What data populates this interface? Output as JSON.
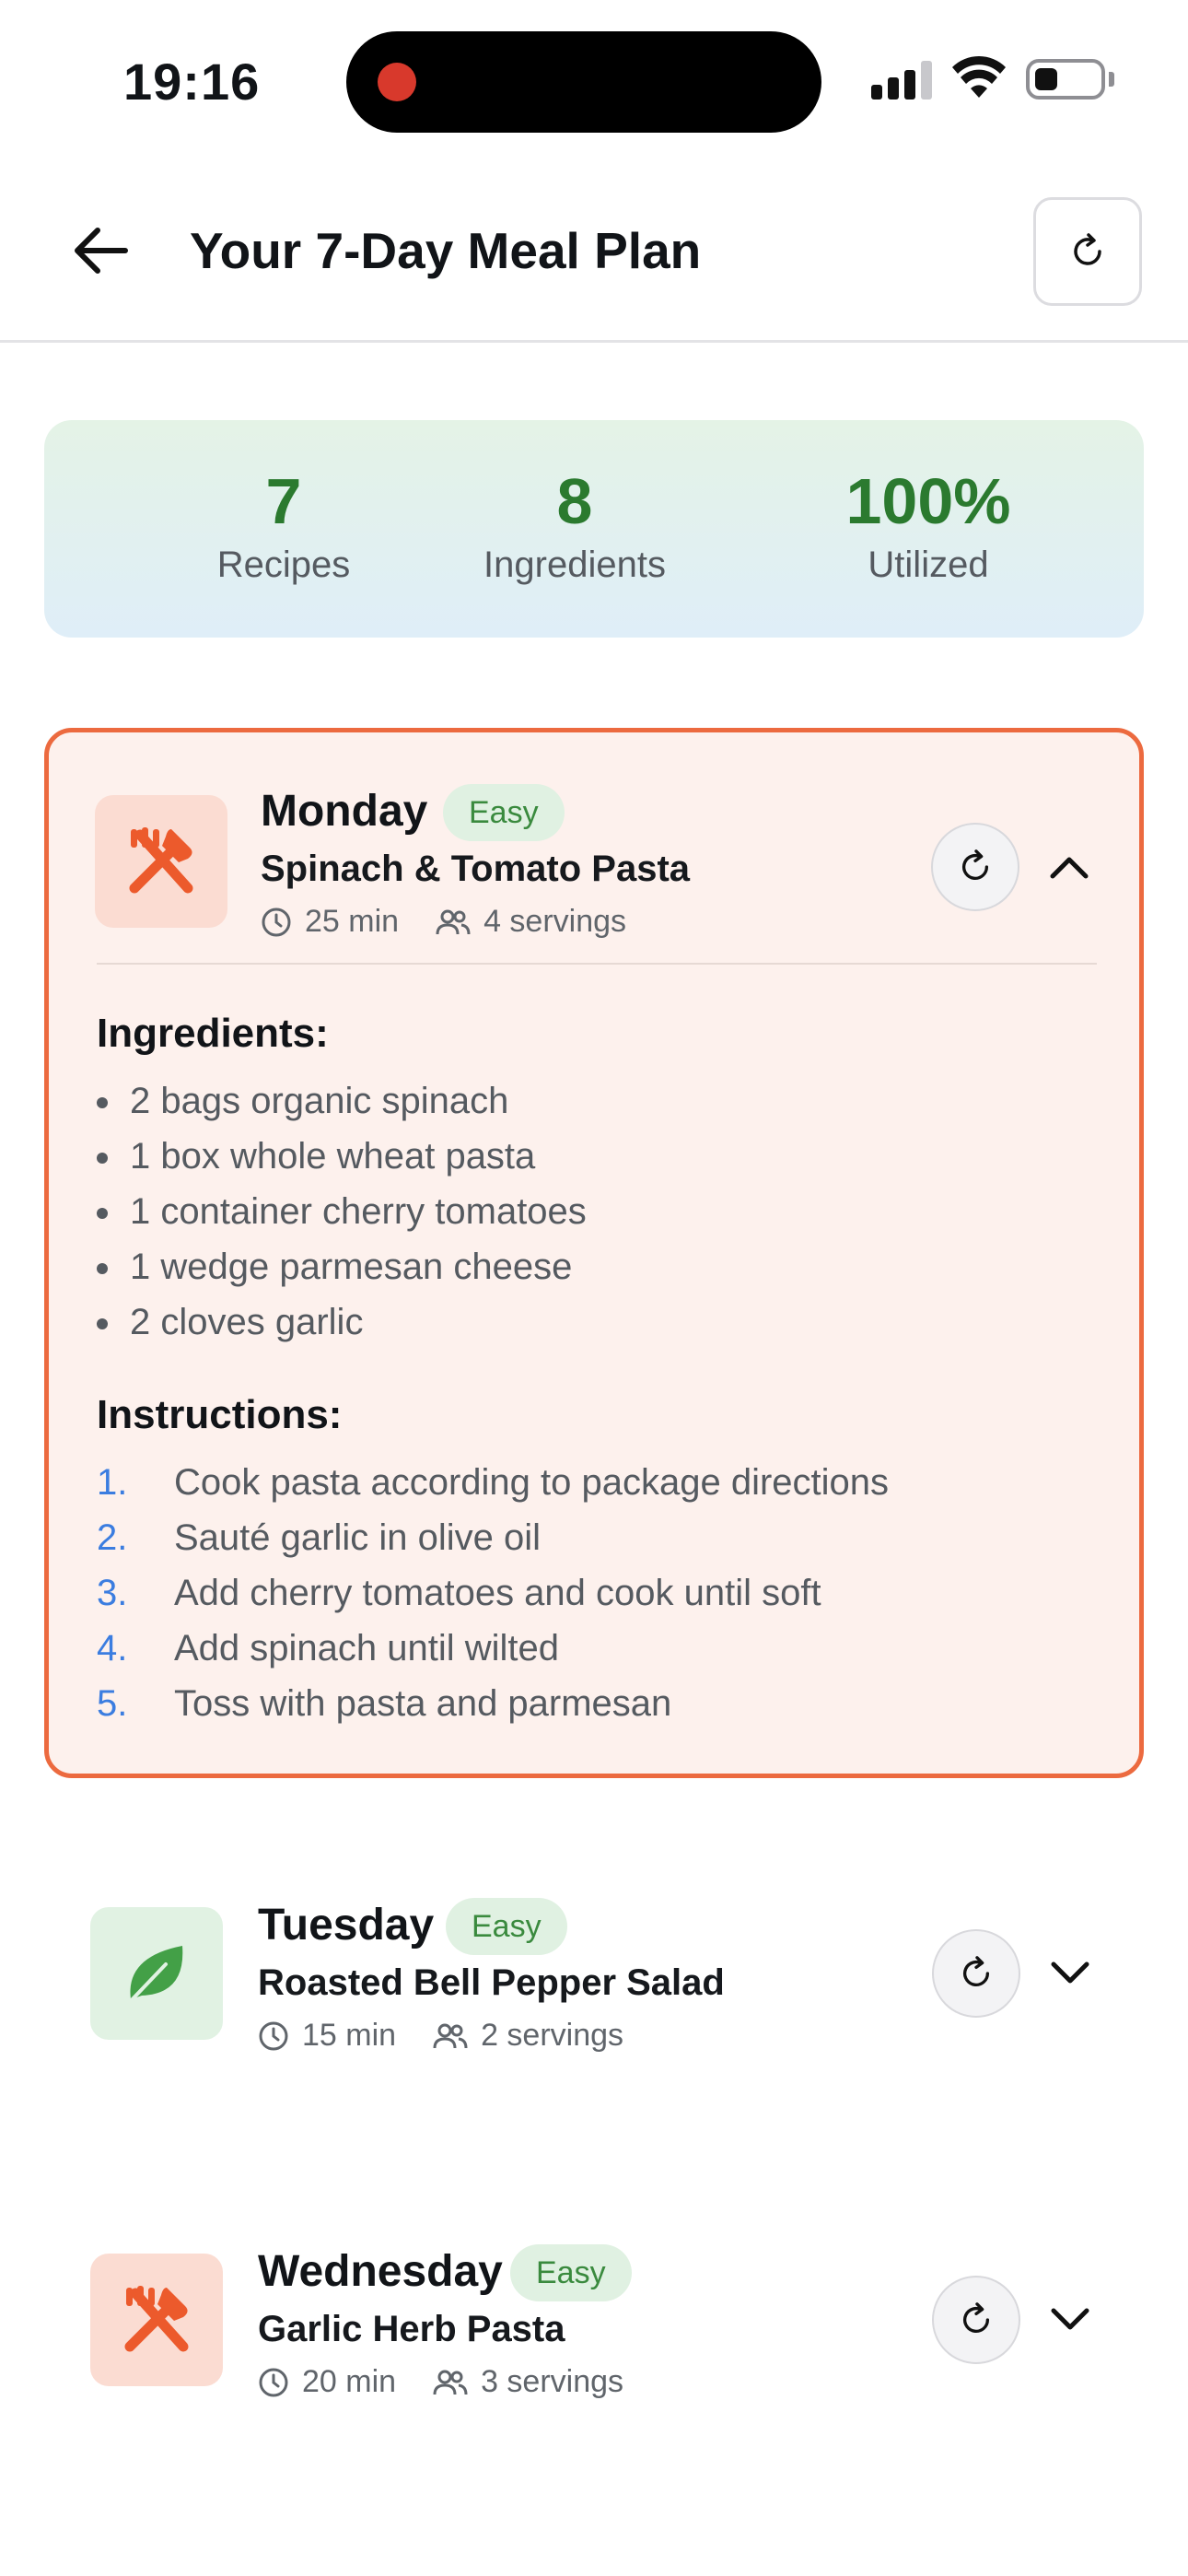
{
  "status_bar": {
    "time": "19:16"
  },
  "header": {
    "title": "Your 7-Day Meal Plan"
  },
  "stats": [
    {
      "value": "7",
      "label": "Recipes"
    },
    {
      "value": "8",
      "label": "Ingredients"
    },
    {
      "value": "100%",
      "label": "Utilized"
    }
  ],
  "meals": [
    {
      "day": "Monday",
      "difficulty": "Easy",
      "name": "Spinach & Tomato Pasta",
      "time": "25 min",
      "servings": "4 servings",
      "icon": "utensils-icon",
      "expanded": true,
      "ingredients_title": "Ingredients:",
      "ingredients": [
        "2 bags organic spinach",
        "1 box whole wheat pasta",
        "1 container cherry tomatoes",
        "1 wedge parmesan cheese",
        "2 cloves garlic"
      ],
      "instructions_title": "Instructions:",
      "instructions": [
        {
          "num": "1.",
          "text": "Cook pasta according to package directions"
        },
        {
          "num": "2.",
          "text": "Sauté garlic in olive oil"
        },
        {
          "num": "3.",
          "text": "Add cherry tomatoes and cook until soft"
        },
        {
          "num": "4.",
          "text": "Add spinach until wilted"
        },
        {
          "num": "5.",
          "text": "Toss with pasta and parmesan"
        }
      ]
    },
    {
      "day": "Tuesday",
      "difficulty": "Easy",
      "name": "Roasted Bell Pepper Salad",
      "time": "15 min",
      "servings": "2 servings",
      "icon": "leaf-icon",
      "expanded": false
    },
    {
      "day": "Wednesday",
      "difficulty": "Easy",
      "name": "Garlic Herb Pasta",
      "time": "20 min",
      "servings": "3 servings",
      "icon": "utensils-icon",
      "expanded": false
    }
  ],
  "colors": {
    "accent_orange": "#ec6a3f",
    "stat_green": "#2b7a2f",
    "badge_green": "#3a8a3e",
    "number_blue": "#3b7de0"
  }
}
